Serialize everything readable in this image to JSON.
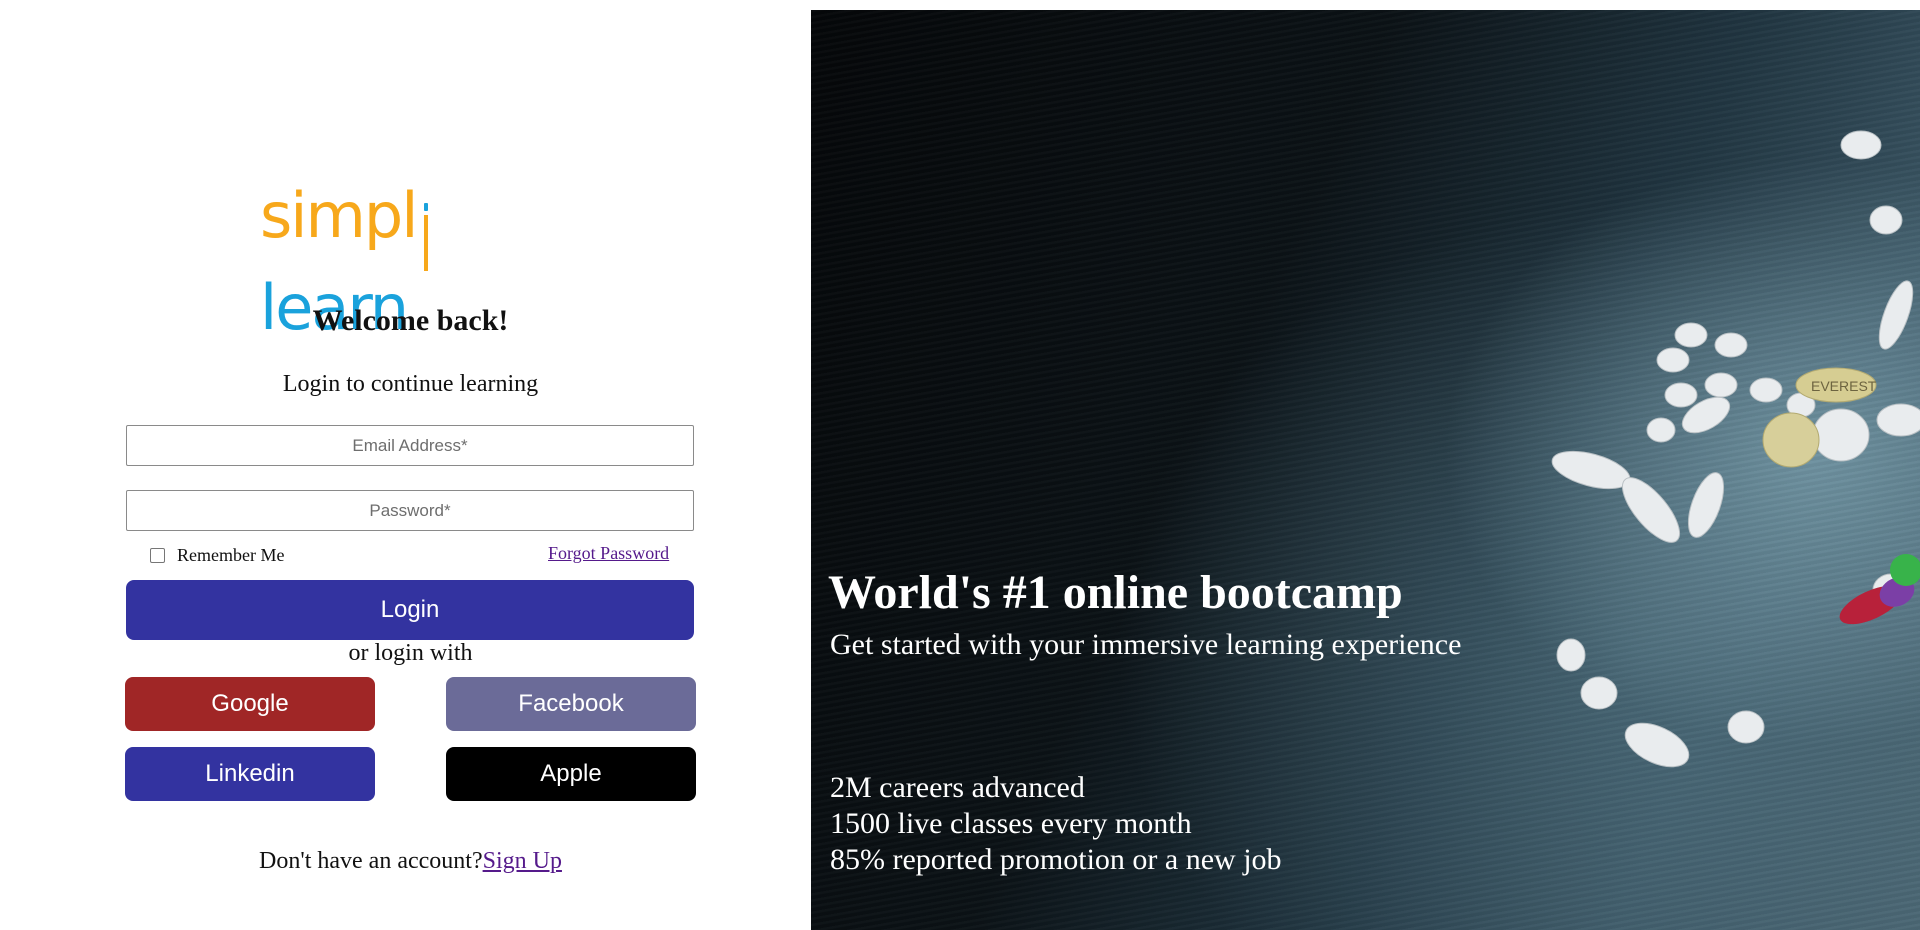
{
  "brand": {
    "logo_part1": "simpl",
    "logo_part2": "learn",
    "color_orange": "#f7a81b",
    "color_blue": "#1aa2dc"
  },
  "login": {
    "welcome": "Welcome back!",
    "subtitle": "Login to continue learning",
    "email_placeholder": "Email Address*",
    "password_placeholder": "Password*",
    "remember_label": "Remember Me",
    "forgot_label": "Forgot Password",
    "login_button": "Login",
    "or_text": "or login with",
    "social": {
      "google": "Google",
      "facebook": "Facebook",
      "linkedin": "Linkedin",
      "apple": "Apple"
    },
    "no_account_text": "Don't have an account?",
    "signup_label": "Sign Up"
  },
  "hero": {
    "title": "World's #1 online bootcamp",
    "subtitle": "Get started with your immersive learning experience",
    "stats": [
      "2M careers advanced",
      "1500 live classes every month",
      "85% reported promotion or a new job"
    ]
  },
  "colors": {
    "primary": "#3333a0",
    "google": "#a02626",
    "facebook": "#6b6b98",
    "linkedin": "#3333a0",
    "apple": "#000000",
    "link": "#551a8b"
  }
}
